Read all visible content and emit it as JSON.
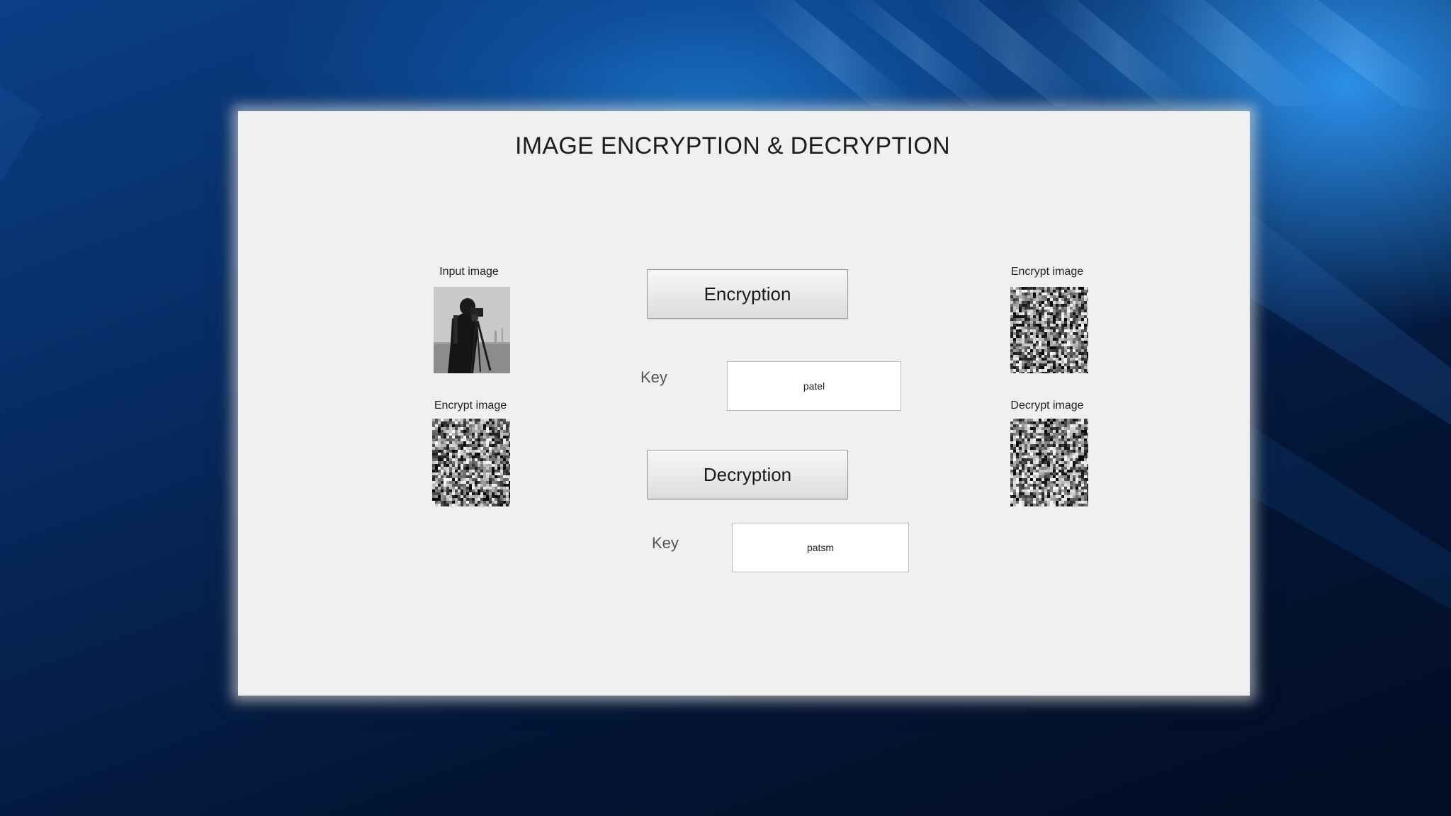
{
  "title": "IMAGE ENCRYPTION & DECRYPTION",
  "left_panel": {
    "input_label": "Input image",
    "encrypt_label": "Encrypt image"
  },
  "right_panel": {
    "encrypt_label": "Encrypt image",
    "decrypt_label": "Decrypt image"
  },
  "encryption": {
    "button_label": "Encryption",
    "key_label": "Key",
    "key_value": "patel"
  },
  "decryption": {
    "button_label": "Decryption",
    "key_label": "Key",
    "key_value": "patsm"
  },
  "icons": {
    "input_image": "camera-man-photo-icon",
    "encrypted_image": "noise-image-icon"
  }
}
